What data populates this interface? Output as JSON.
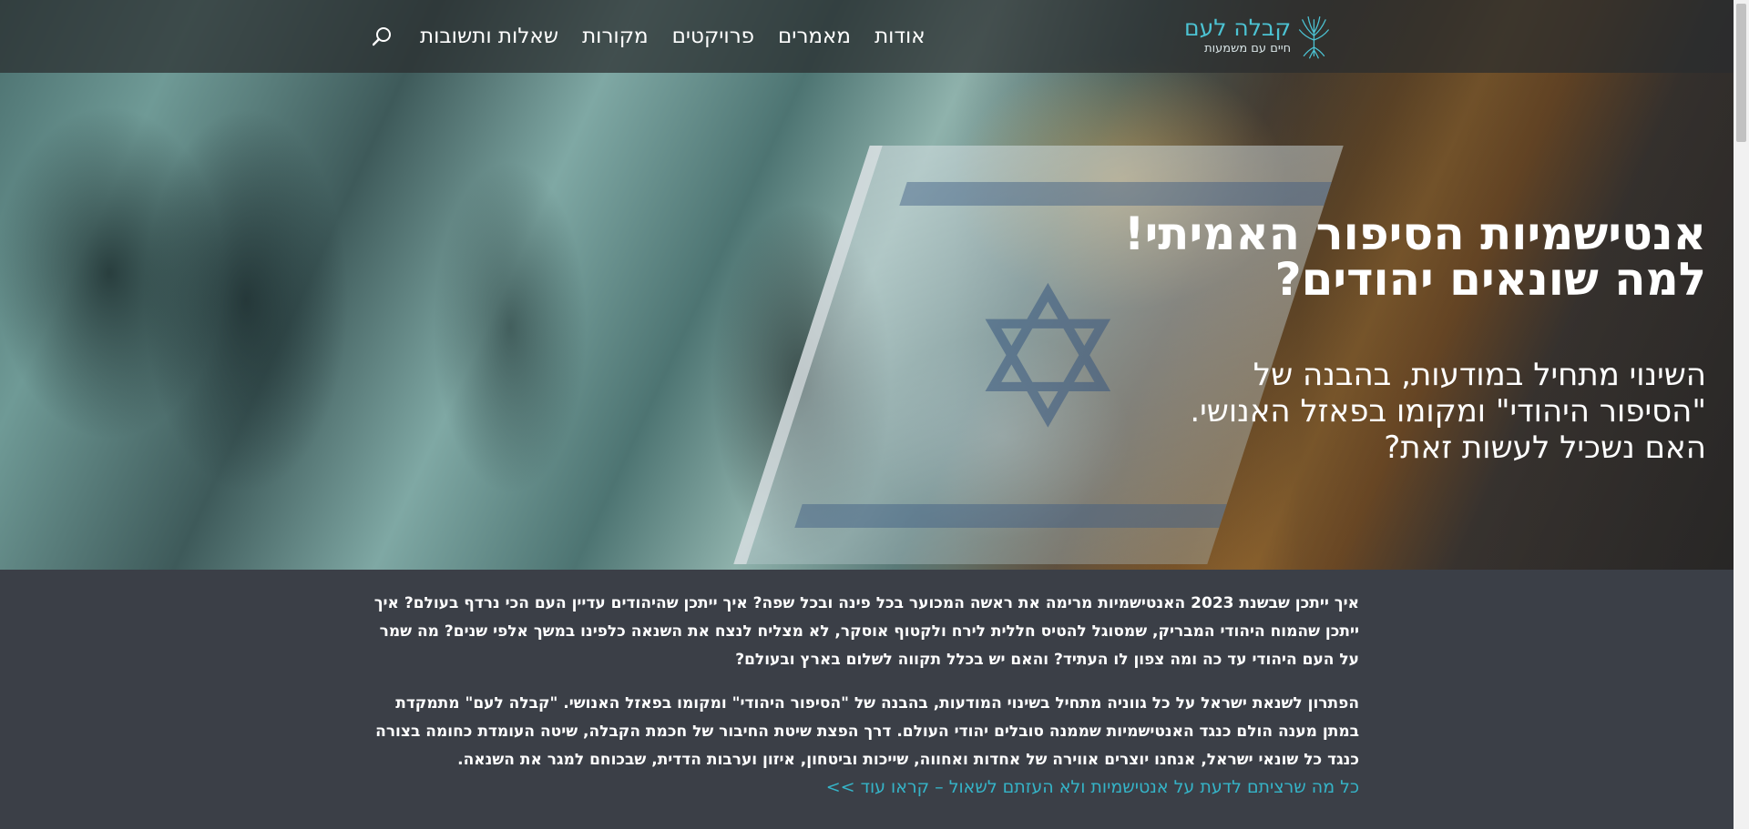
{
  "header": {
    "logo": {
      "title": "קבלה לעם",
      "subtitle": "חיים עם משמעות"
    },
    "nav": [
      {
        "key": "about",
        "label": "אודות"
      },
      {
        "key": "articles",
        "label": "מאמרים"
      },
      {
        "key": "projects",
        "label": "פרויקטים"
      },
      {
        "key": "sources",
        "label": "מקורות"
      },
      {
        "key": "qa",
        "label": "שאלות ותשובות"
      }
    ],
    "search_icon": "search-icon"
  },
  "hero": {
    "title_line1": "אנטישמיות הסיפור האמיתי!",
    "title_line2": "למה שונאים יהודים?",
    "subtitle_line1": "השינוי מתחיל במודעות, בהבנה של",
    "subtitle_line2": "\"הסיפור היהודי\" ומקומו בפאזל האנושי.",
    "subtitle_line3": "האם נשכיל לעשות זאת?"
  },
  "content": {
    "paragraph1": "איך ייתכן שבשנת 2023 האנטישמיות מרימה את ראשה המכוער בכל פינה ובכל שפה? איך ייתכן שהיהודים עדיין העם הכי נרדף בעולם? איך ייתכן שהמוח היהודי המבריק, שמסוגל להטיס חללית לירח ולקטוף אוסקר, לא מצליח לנצח את השנאה כלפינו במשך אלפי שנים? מה שמר על העם היהודי עד כה ומה צפון לו העתיד? והאם יש בכלל תקווה לשלום בארץ ובעולם?",
    "paragraph2": "הפתרון לשנאת ישראל על כל גווניה מתחיל בשינוי המודעות, בהבנה של \"הסיפור היהודי\" ומקומו בפאזל האנושי. \"קבלה לעם\" מתמקדת במתן מענה הולם כנגד האנטישמיות שממנה סובלים יהודי העולם. דרך הפצת שיטת החיבור של חכמת הקבלה, שיטה העומדת כחומה בצורה כנגד כל שונאי ישראל, אנחנו יוצרים אווירה של אחדות ואחווה, שייכות וביטחון, איזון וערבות הדדית, שבכוחם למגר את השנאה.",
    "read_more": "כל מה שרציתם לדעת על אנטישמיות ולא העזתם לשאול – קראו עוד >>"
  },
  "colors": {
    "accent": "#35b4c8",
    "logo": "#4cc3d3",
    "page_bg": "#3b3f47"
  }
}
